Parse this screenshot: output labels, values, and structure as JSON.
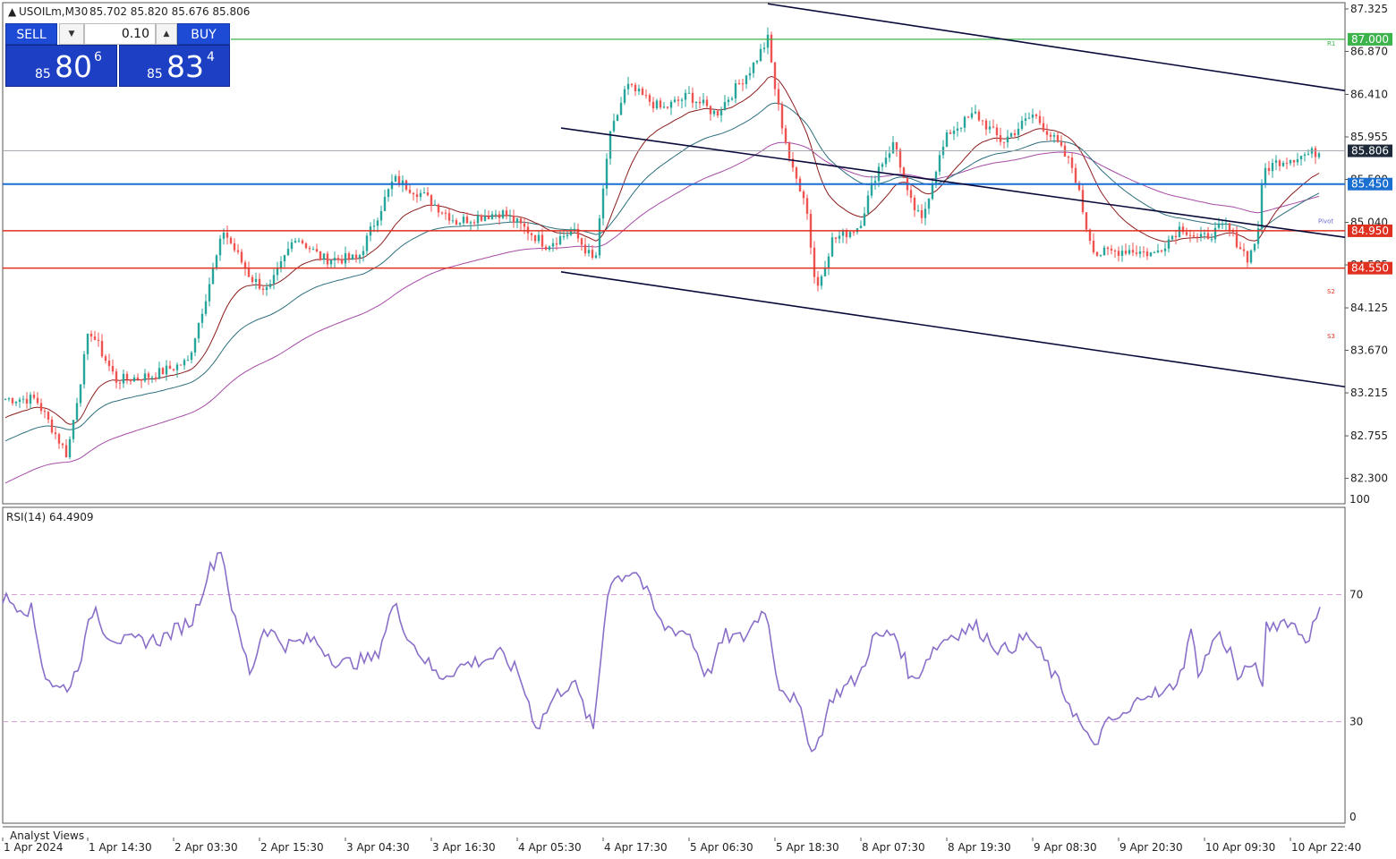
{
  "symbol_title": "USOILm,M30",
  "ohlc": "85.702 85.820 85.676 85.806",
  "trade_panel": {
    "sell_label": "SELL",
    "buy_label": "BUY",
    "lot": "0.10",
    "sell_price_small": "85",
    "sell_price_big": "80",
    "sell_price_sup": "6",
    "buy_price_small": "85",
    "buy_price_big": "83",
    "buy_price_sup": "4"
  },
  "price_axis": {
    "ticks": [
      "87.325",
      "86.870",
      "86.410",
      "85.955",
      "85.500",
      "85.040",
      "84.585",
      "84.125",
      "83.670",
      "83.215",
      "82.755",
      "82.300"
    ],
    "tags": [
      {
        "label": "87.000",
        "color": "#3cb44b"
      },
      {
        "label": "85.806",
        "color": "#1e2a3a"
      },
      {
        "label": "85.450",
        "color": "#1a6fd1"
      },
      {
        "label": "84.950",
        "color": "#e03020"
      },
      {
        "label": "84.550",
        "color": "#e03020"
      }
    ]
  },
  "pivot_labels": [
    "R1",
    "Pivot",
    "S2",
    "S3"
  ],
  "rsi": {
    "title": "RSI(14) 64.4909",
    "ticks": [
      "100",
      "70",
      "30",
      "0"
    ]
  },
  "time_axis": [
    "1 Apr 2024",
    "1 Apr 14:30",
    "2 Apr 03:30",
    "2 Apr 15:30",
    "3 Apr 04:30",
    "3 Apr 16:30",
    "4 Apr 05:30",
    "4 Apr 17:30",
    "5 Apr 06:30",
    "5 Apr 18:30",
    "8 Apr 07:30",
    "8 Apr 19:30",
    "9 Apr 08:30",
    "9 Apr 20:30",
    "10 Apr 09:30",
    "10 Apr 22:40"
  ],
  "bottom_label": "Analyst Views",
  "colors": {
    "bull": "#26a69a",
    "bear": "#ef5350",
    "rsi": "#8a6fc9",
    "ma_fast": "#8b1c1c",
    "ma_mid": "#2e6f7e",
    "ma_slow": "#a64ca6",
    "channel": "#0a0a3a"
  },
  "chart_data": {
    "type": "candlestick",
    "price_key_points": [
      [
        0,
        83.15
      ],
      [
        40,
        83.15
      ],
      [
        75,
        82.55
      ],
      [
        100,
        83.9
      ],
      [
        130,
        83.35
      ],
      [
        170,
        83.4
      ],
      [
        210,
        83.55
      ],
      [
        250,
        84.95
      ],
      [
        280,
        84.45
      ],
      [
        300,
        84.3
      ],
      [
        330,
        84.9
      ],
      [
        360,
        84.65
      ],
      [
        400,
        84.65
      ],
      [
        440,
        85.5
      ],
      [
        470,
        85.35
      ],
      [
        510,
        85.05
      ],
      [
        560,
        85.15
      ],
      [
        590,
        84.95
      ],
      [
        610,
        84.8
      ],
      [
        640,
        84.95
      ],
      [
        665,
        84.6
      ],
      [
        680,
        85.9
      ],
      [
        700,
        86.5
      ],
      [
        740,
        86.25
      ],
      [
        770,
        86.4
      ],
      [
        800,
        86.2
      ],
      [
        840,
        86.7
      ],
      [
        858,
        87.0
      ],
      [
        868,
        86.35
      ],
      [
        885,
        85.6
      ],
      [
        900,
        85.3
      ],
      [
        912,
        84.3
      ],
      [
        930,
        84.85
      ],
      [
        960,
        85.0
      ],
      [
        980,
        85.6
      ],
      [
        1000,
        85.9
      ],
      [
        1015,
        85.3
      ],
      [
        1030,
        85.05
      ],
      [
        1045,
        85.6
      ],
      [
        1060,
        86.0
      ],
      [
        1090,
        86.2
      ],
      [
        1120,
        85.9
      ],
      [
        1155,
        86.2
      ],
      [
        1180,
        85.9
      ],
      [
        1200,
        85.6
      ],
      [
        1215,
        84.95
      ],
      [
        1225,
        84.7
      ],
      [
        1260,
        84.75
      ],
      [
        1290,
        84.7
      ],
      [
        1320,
        85.0
      ],
      [
        1340,
        84.85
      ],
      [
        1370,
        85.0
      ],
      [
        1395,
        84.65
      ],
      [
        1405,
        84.9
      ],
      [
        1412,
        85.6
      ],
      [
        1430,
        85.7
      ],
      [
        1475,
        85.8
      ]
    ],
    "channel_lines": [
      {
        "from": [
          858,
          87.38
        ],
        "to": [
          1503,
          86.45
        ]
      },
      {
        "from": [
          627,
          86.05
        ],
        "to": [
          1503,
          84.88
        ]
      },
      {
        "from": [
          627,
          84.51
        ],
        "to": [
          1503,
          83.28
        ]
      }
    ],
    "horizontal_levels": [
      87.0,
      85.806,
      85.45,
      84.95,
      84.55
    ],
    "rsi_levels": [
      70,
      30
    ]
  }
}
